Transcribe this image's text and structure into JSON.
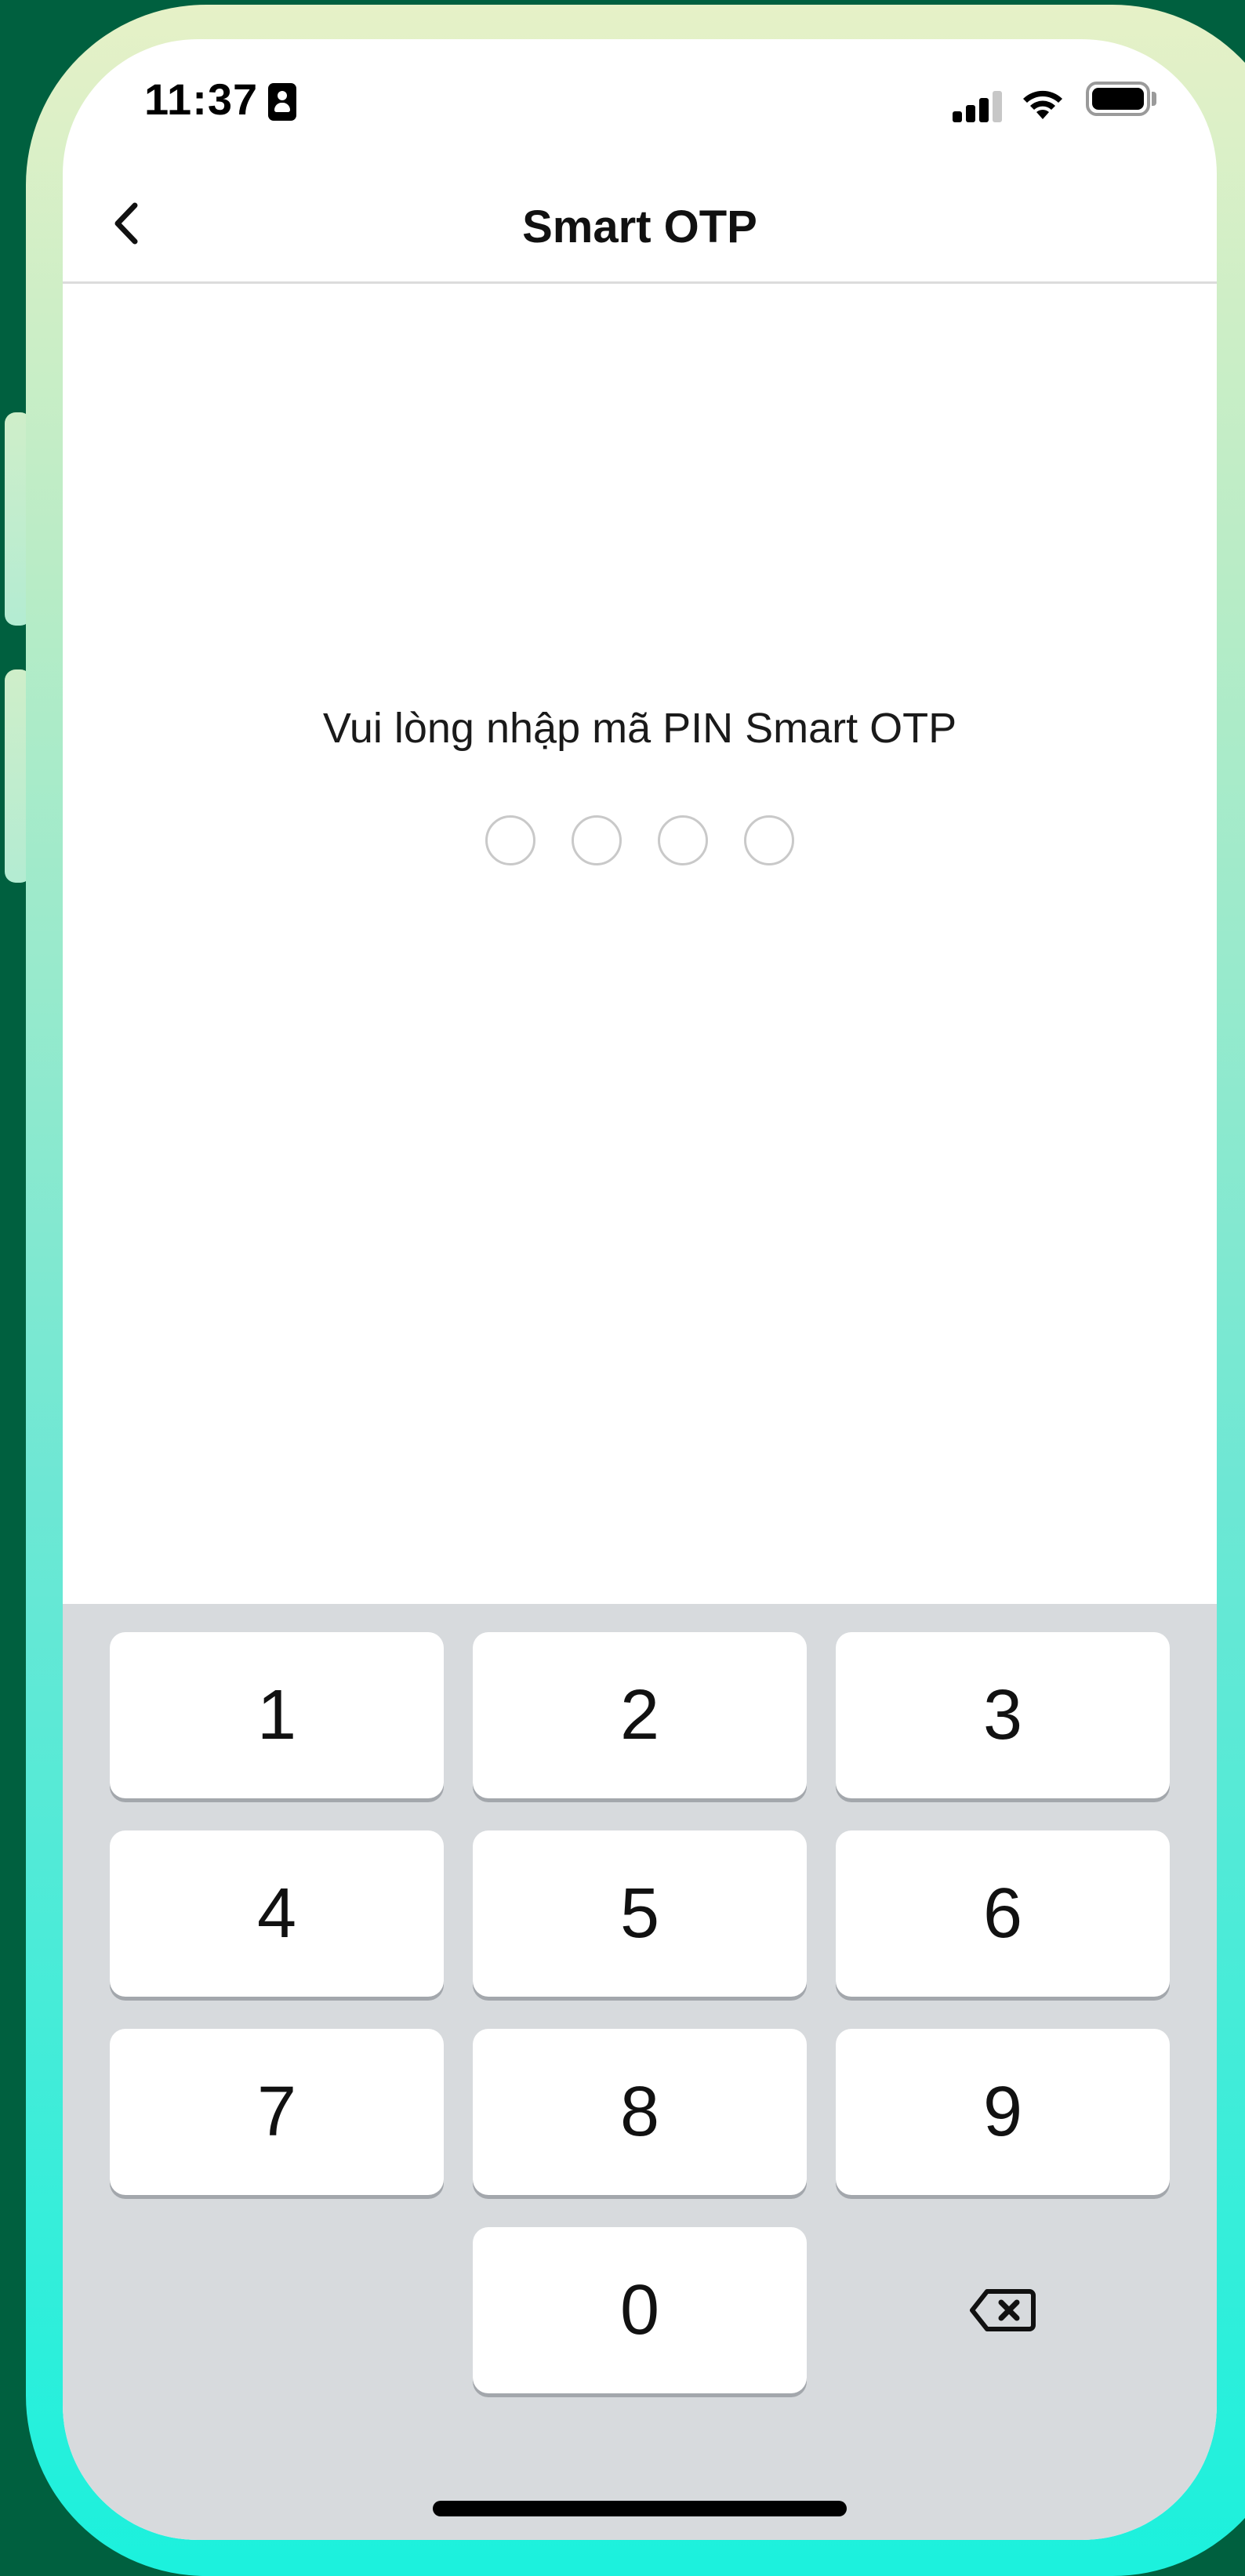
{
  "status_bar": {
    "time": "11:37",
    "icons": [
      "contact-card-icon",
      "cellular-signal-icon",
      "wifi-icon",
      "battery-icon"
    ]
  },
  "nav": {
    "title": "Smart OTP",
    "back_icon": "chevron-left-icon"
  },
  "pin_entry": {
    "prompt": "Vui lòng nhập mã PIN Smart OTP",
    "length": 4,
    "filled": 0
  },
  "keypad": {
    "keys": [
      "1",
      "2",
      "3",
      "4",
      "5",
      "6",
      "7",
      "8",
      "9",
      "0"
    ],
    "delete_icon": "backspace-icon"
  },
  "colors": {
    "background": "#00603f",
    "frame_top": "#e6f1c7",
    "frame_bottom": "#1bf1dd",
    "keypad_bg": "#d7dadd",
    "dot_border": "#c9c9c9"
  }
}
